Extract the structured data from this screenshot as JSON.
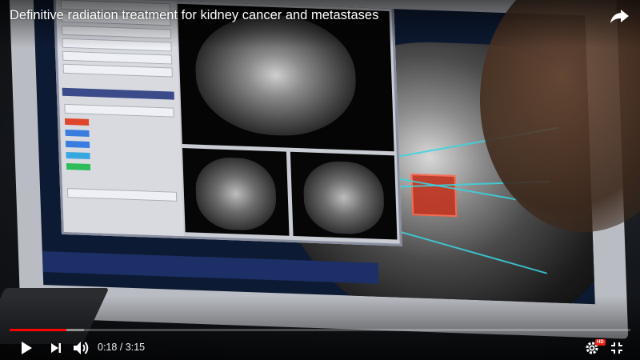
{
  "video": {
    "title": "Definitive radiation treatment for kidney cancer and metastases",
    "current_time": "0:18",
    "separator": "/",
    "duration": "3:15",
    "progress_fraction": 0.092,
    "buffered_fraction": 0.12
  },
  "controls": {
    "play_icon": "play-icon",
    "next_icon": "next-icon",
    "volume_icon": "volume-icon",
    "settings_icon": "gear-icon",
    "hd_badge": "HD",
    "fullscreen_icon": "exit-fullscreen-icon",
    "share_icon": "share-icon"
  },
  "colors": {
    "progress_played": "#ff0000",
    "hd_badge": "#e62117",
    "beam": "#39d5e0",
    "tumor": "#c0341f"
  }
}
